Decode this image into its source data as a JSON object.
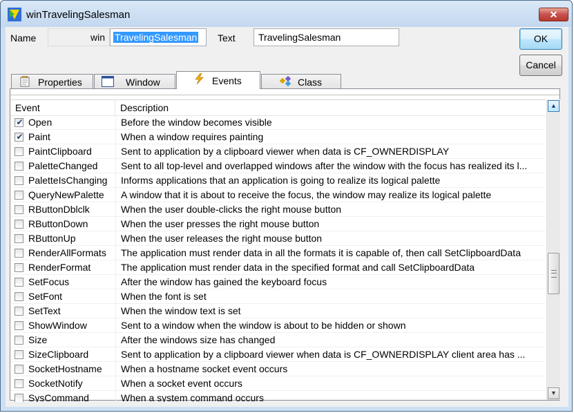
{
  "window": {
    "title": "winTravelingSalesman",
    "close_label": "✕"
  },
  "header": {
    "name_label": "Name",
    "name_prefix": "win",
    "name_value": "TravelingSalesman",
    "text_label": "Text",
    "text_value": "TravelingSalesman"
  },
  "buttons": {
    "ok": "OK",
    "cancel": "Cancel"
  },
  "tabs": [
    {
      "label": "Properties",
      "icon": "properties-icon",
      "active": false
    },
    {
      "label": "Window",
      "icon": "window-icon",
      "active": false
    },
    {
      "label": "Events",
      "icon": "lightning-icon",
      "active": true
    },
    {
      "label": "Class",
      "icon": "class-icon",
      "active": false
    }
  ],
  "grid": {
    "columns": [
      "Event",
      "Description"
    ],
    "rows": [
      {
        "checked": true,
        "event": "Open",
        "description": "Before the window becomes visible"
      },
      {
        "checked": true,
        "event": "Paint",
        "description": "When a window requires painting"
      },
      {
        "checked": false,
        "event": "PaintClipboard",
        "description": "Sent to application by a clipboard viewer when data is CF_OWNERDISPLAY"
      },
      {
        "checked": false,
        "event": "PaletteChanged",
        "description": "Sent to all top-level and overlapped windows after the window with the focus has realized its l..."
      },
      {
        "checked": false,
        "event": "PaletteIsChanging",
        "description": "Informs applications that an application is going to realize its logical palette"
      },
      {
        "checked": false,
        "event": "QueryNewPalette",
        "description": "A window that it is about to receive the focus, the window may realize its logical palette"
      },
      {
        "checked": false,
        "event": "RButtonDblclk",
        "description": "When the user double-clicks the right mouse button"
      },
      {
        "checked": false,
        "event": "RButtonDown",
        "description": "When the user presses the right mouse button"
      },
      {
        "checked": false,
        "event": "RButtonUp",
        "description": "When the user releases the right mouse button"
      },
      {
        "checked": false,
        "event": "RenderAllFormats",
        "description": "The application must render data in all the formats it is capable of, then call SetClipboardData"
      },
      {
        "checked": false,
        "event": "RenderFormat",
        "description": "The application must render data in the specified format and call SetClipboardData"
      },
      {
        "checked": false,
        "event": "SetFocus",
        "description": "After the window has gained the keyboard focus"
      },
      {
        "checked": false,
        "event": "SetFont",
        "description": "When the font is set"
      },
      {
        "checked": false,
        "event": "SetText",
        "description": "When the window text is set"
      },
      {
        "checked": false,
        "event": "ShowWindow",
        "description": "Sent to a window when the window is about to be hidden or shown"
      },
      {
        "checked": false,
        "event": "Size",
        "description": "After the windows size has changed"
      },
      {
        "checked": false,
        "event": "SizeClipboard",
        "description": "Sent to application by a clipboard viewer when data is CF_OWNERDISPLAY client area has ..."
      },
      {
        "checked": false,
        "event": "SocketHostname",
        "description": "When a hostname socket event occurs"
      },
      {
        "checked": false,
        "event": "SocketNotify",
        "description": "When a socket event occurs"
      },
      {
        "checked": false,
        "event": "SysCommand",
        "description": "When a system command occurs"
      }
    ]
  },
  "colors": {
    "selection": "#3399ff",
    "frame": "#cde0f3",
    "accent_button": "#bee6fd"
  }
}
